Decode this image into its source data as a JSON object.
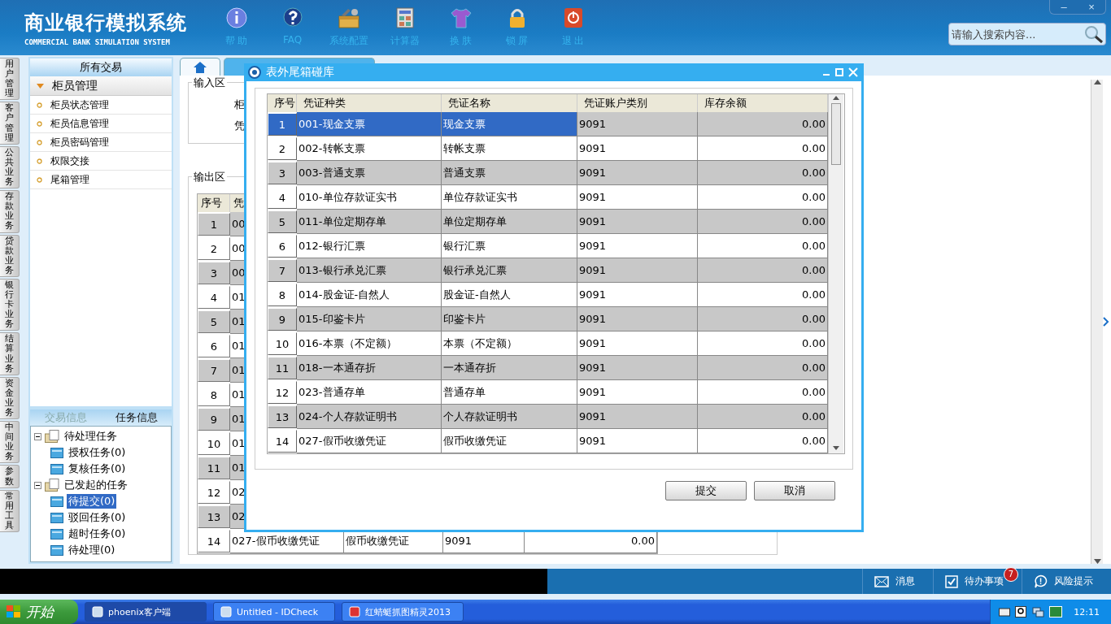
{
  "header": {
    "title": "商业银行模拟系统",
    "subtitle": "COMMERCIAL BANK SIMULATION SYSTEM",
    "toolbar": [
      {
        "kind": "info",
        "label": "帮 助"
      },
      {
        "kind": "faq",
        "label": "FAQ"
      },
      {
        "kind": "config",
        "label": "系统配置"
      },
      {
        "kind": "calculator",
        "label": "计算器"
      },
      {
        "kind": "skin",
        "label": "换 肤"
      },
      {
        "kind": "lock",
        "label": "锁 屏"
      },
      {
        "kind": "exit",
        "label": "退 出"
      }
    ],
    "window_controls": [
      "–",
      "×"
    ],
    "search": {
      "placeholder": "请输入搜索内容..."
    }
  },
  "module_tabs": [
    "用户管理",
    "客户管理",
    "公共业务",
    "存款业务",
    "贷款业务",
    "银行卡业务",
    "结算业务",
    "资金业务",
    "中间业务",
    "参数",
    "常用工具"
  ],
  "sidebar": {
    "title": "所有交易",
    "group": {
      "label": "柜员管理",
      "expanded": true,
      "items": [
        "柜员状态管理",
        "柜员信息管理",
        "柜员密码管理",
        "权限交接",
        "尾箱管理"
      ]
    },
    "info_tabs": [
      {
        "label": "交易信息",
        "selected": false
      },
      {
        "label": "任务信息",
        "selected": true
      }
    ],
    "tree": [
      {
        "label": "待处理任务",
        "expanded": true,
        "children": [
          {
            "label": "授权任务(0)",
            "selected": false
          },
          {
            "label": "复核任务(0)",
            "selected": false
          }
        ]
      },
      {
        "label": "已发起的任务",
        "expanded": true,
        "children": [
          {
            "label": "待提交(0)",
            "selected": true
          },
          {
            "label": "驳回任务(0)",
            "selected": false
          },
          {
            "label": "超时任务(0)",
            "selected": false
          },
          {
            "label": "待处理(0)",
            "selected": false
          }
        ]
      }
    ]
  },
  "main": {
    "tabs": [
      {
        "kind": "home",
        "selected": false
      },
      {
        "kind": "page",
        "selected": true
      }
    ],
    "input_area": {
      "legend": "输入区",
      "labels": [
        "柜",
        "凭"
      ]
    },
    "output_area": {
      "legend": "输出区",
      "columns": [
        "序号",
        "凭"
      ],
      "rows": [
        {
          "no": "1",
          "kind": "00"
        },
        {
          "no": "2",
          "kind": "00"
        },
        {
          "no": "3",
          "kind": "00"
        },
        {
          "no": "4",
          "kind": "01"
        },
        {
          "no": "5",
          "kind": "01"
        },
        {
          "no": "6",
          "kind": "01"
        },
        {
          "no": "7",
          "kind": "01"
        },
        {
          "no": "8",
          "kind": "01"
        },
        {
          "no": "9",
          "kind": "01"
        },
        {
          "no": "10",
          "kind": "01"
        },
        {
          "no": "11",
          "kind": "01"
        },
        {
          "no": "12",
          "kind": "02"
        },
        {
          "no": "13",
          "kind": "02"
        },
        {
          "no": "14",
          "kind": "027-假币收缴凭证",
          "name": "假币收缴凭证",
          "account": "9091",
          "balance": "0.00"
        }
      ]
    }
  },
  "dialog": {
    "title": "表外尾箱碰库",
    "columns": [
      "序号",
      "凭证种类",
      "凭证名称",
      "凭证账户类别",
      "库存余额"
    ],
    "rows": [
      {
        "no": "1",
        "kind": "001-现金支票",
        "name": "现金支票",
        "account": "9091",
        "balance": "0.00",
        "selected": true
      },
      {
        "no": "2",
        "kind": "002-转帐支票",
        "name": "转帐支票",
        "account": "9091",
        "balance": "0.00",
        "selected": false
      },
      {
        "no": "3",
        "kind": "003-普通支票",
        "name": "普通支票",
        "account": "9091",
        "balance": "0.00",
        "selected": false
      },
      {
        "no": "4",
        "kind": "010-单位存款证实书",
        "name": "单位存款证实书",
        "account": "9091",
        "balance": "0.00",
        "selected": false
      },
      {
        "no": "5",
        "kind": "011-单位定期存单",
        "name": "单位定期存单",
        "account": "9091",
        "balance": "0.00",
        "selected": false
      },
      {
        "no": "6",
        "kind": "012-银行汇票",
        "name": "银行汇票",
        "account": "9091",
        "balance": "0.00",
        "selected": false
      },
      {
        "no": "7",
        "kind": "013-银行承兑汇票",
        "name": "银行承兑汇票",
        "account": "9091",
        "balance": "0.00",
        "selected": false
      },
      {
        "no": "8",
        "kind": "014-股金证-自然人",
        "name": "股金证-自然人",
        "account": "9091",
        "balance": "0.00",
        "selected": false
      },
      {
        "no": "9",
        "kind": "015-印鉴卡片",
        "name": "印鉴卡片",
        "account": "9091",
        "balance": "0.00",
        "selected": false
      },
      {
        "no": "10",
        "kind": "016-本票（不定额）",
        "name": "本票（不定额）",
        "account": "9091",
        "balance": "0.00",
        "selected": false
      },
      {
        "no": "11",
        "kind": "018-一本通存折",
        "name": "一本通存折",
        "account": "9091",
        "balance": "0.00",
        "selected": false
      },
      {
        "no": "12",
        "kind": "023-普通存单",
        "name": "普通存单",
        "account": "9091",
        "balance": "0.00",
        "selected": false
      },
      {
        "no": "13",
        "kind": "024-个人存款证明书",
        "name": "个人存款证明书",
        "account": "9091",
        "balance": "0.00",
        "selected": false
      },
      {
        "no": "14",
        "kind": "027-假币收缴凭证",
        "name": "假币收缴凭证",
        "account": "9091",
        "balance": "0.00",
        "selected": false
      }
    ],
    "buttons": [
      "提交",
      "取消"
    ]
  },
  "status_bar": {
    "items": [
      {
        "kind": "message",
        "label": "消息"
      },
      {
        "kind": "todo",
        "label": "待办事项",
        "badge": "7"
      },
      {
        "kind": "risk",
        "label": "风险提示"
      }
    ]
  },
  "taskbar": {
    "start": "开始",
    "tasks": [
      {
        "label": "phoenix客户端",
        "selected": true
      },
      {
        "label": "Untitled - IDCheck",
        "selected": false
      },
      {
        "label": "红蜻蜓抓图精灵2013",
        "selected": false
      }
    ],
    "clock": "12:11"
  }
}
